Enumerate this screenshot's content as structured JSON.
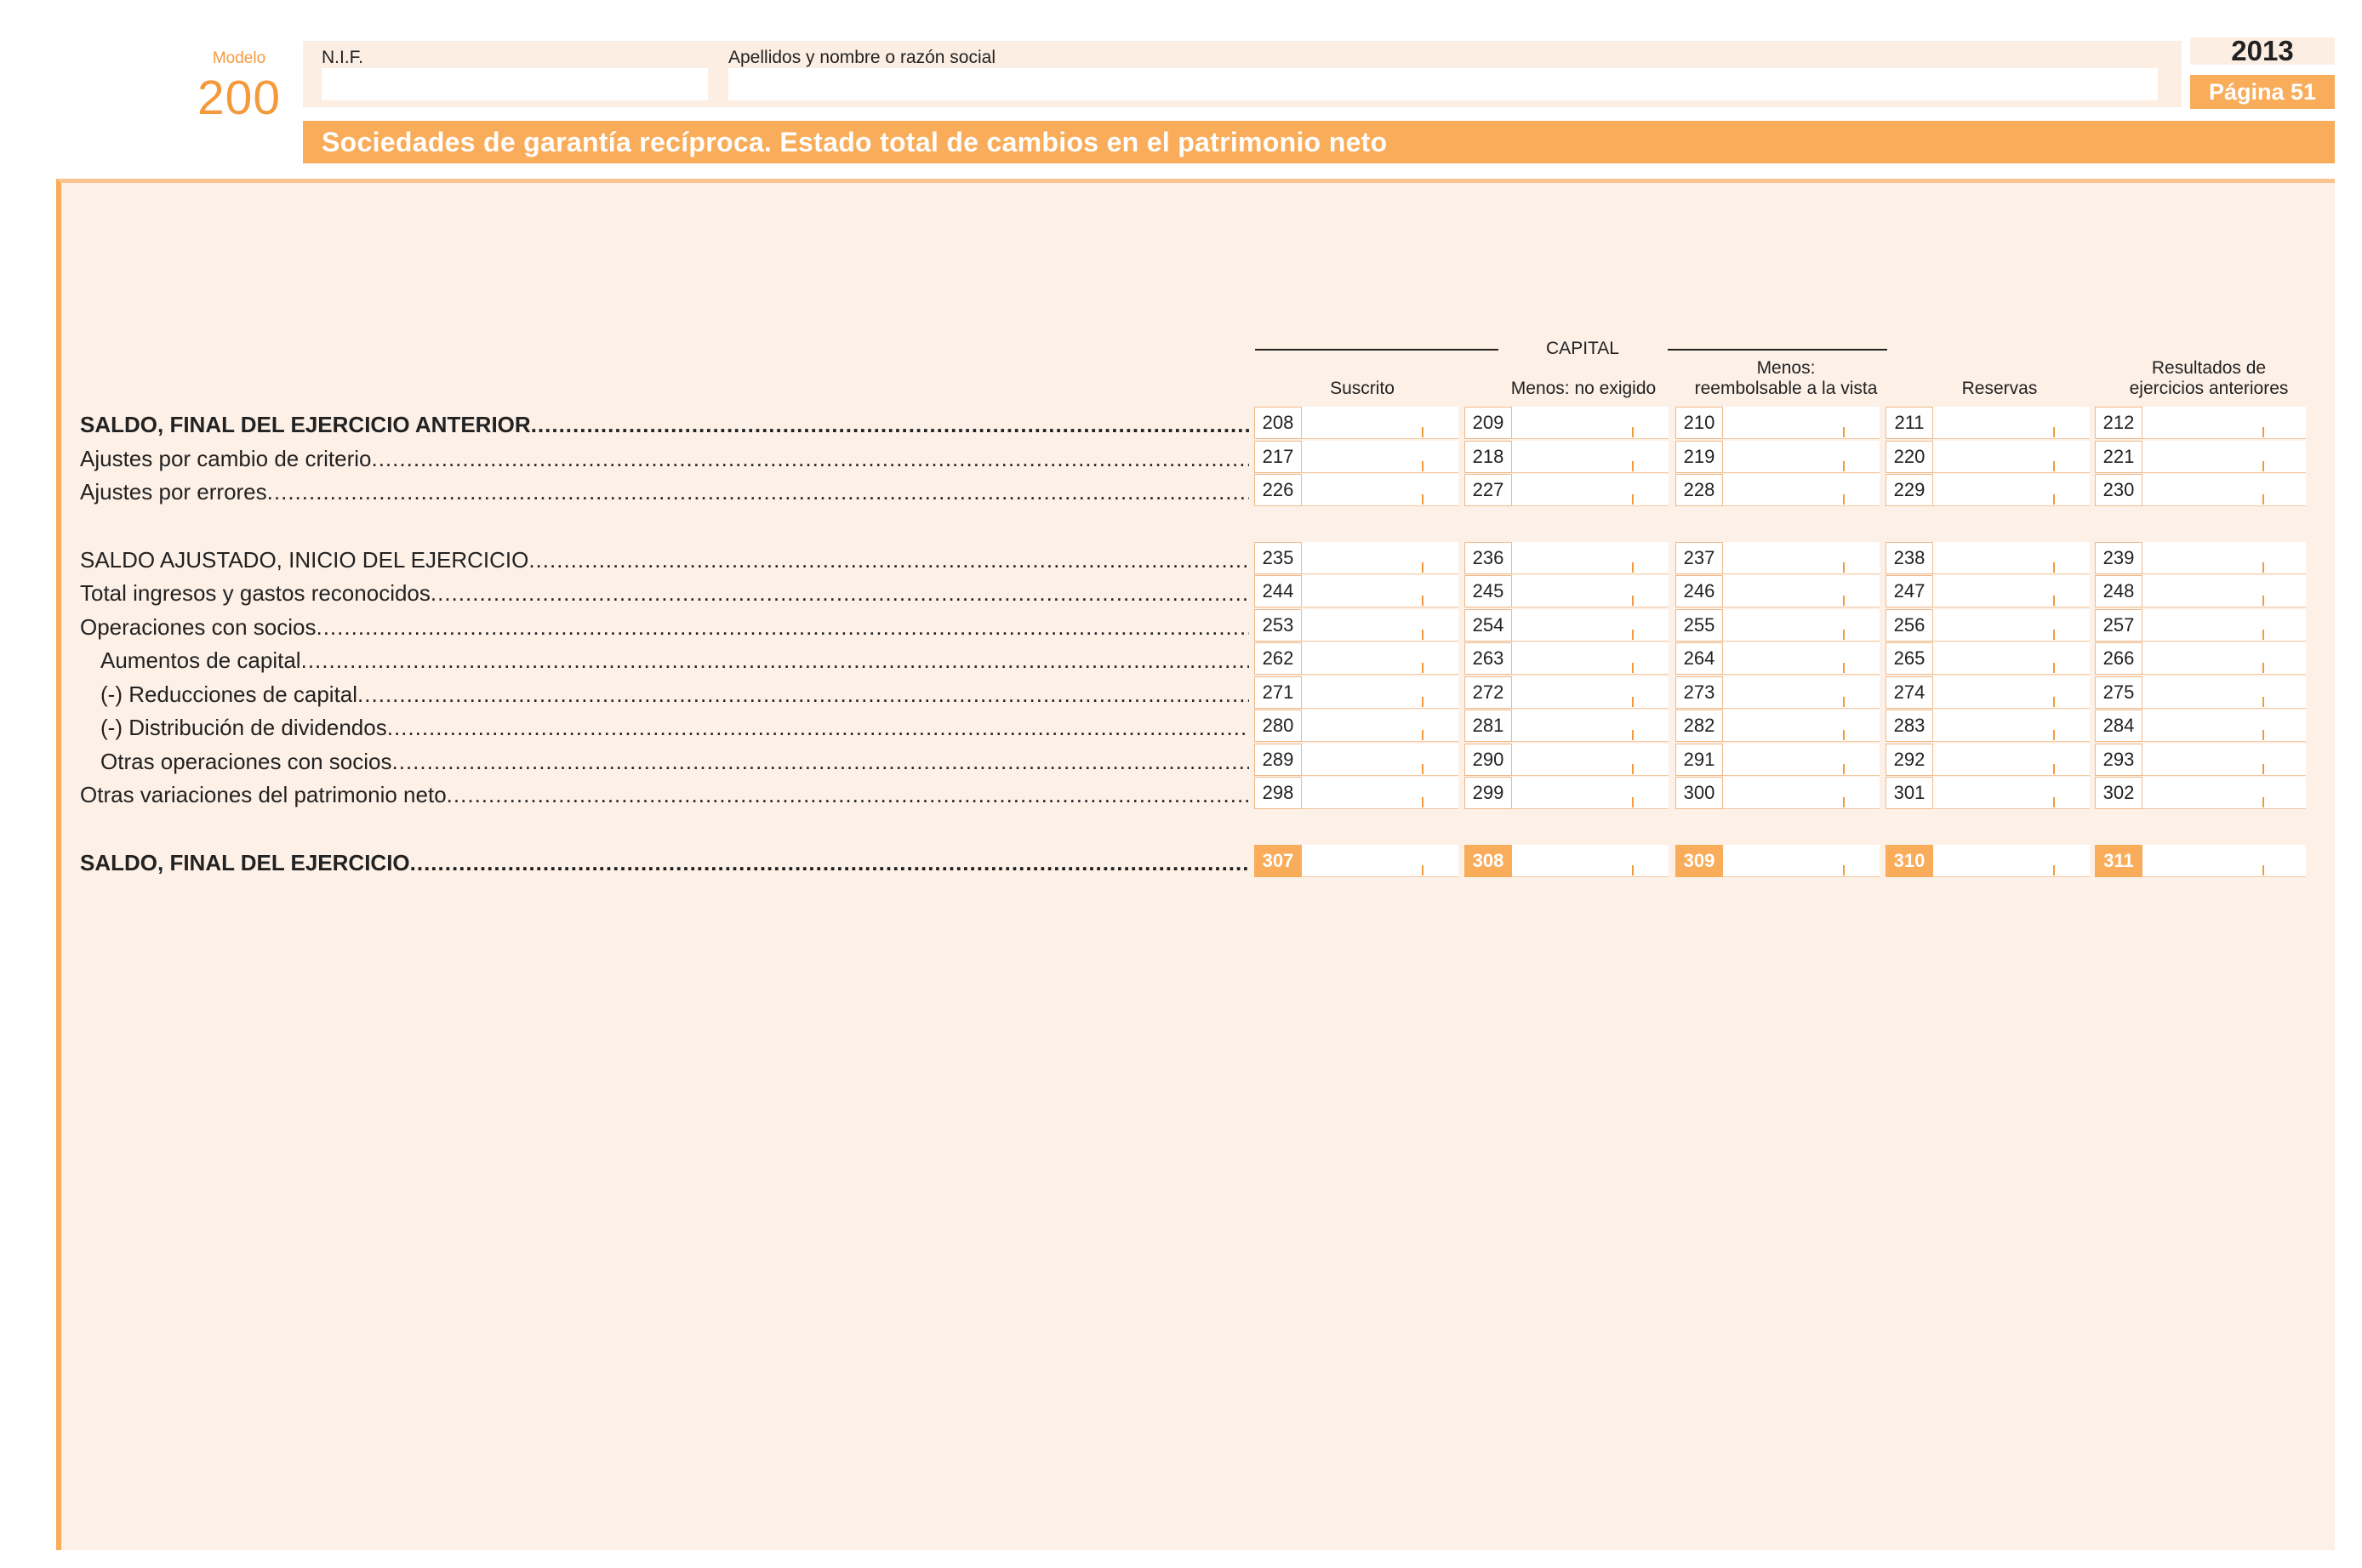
{
  "header": {
    "modelo_label": "Modelo",
    "modelo_number": "200",
    "nif_label": "N.I.F.",
    "name_label": "Apellidos y nombre o razón social",
    "nif_value": "",
    "name_value": "",
    "year": "2013",
    "page": "Página 51",
    "title": "Sociedades de garantía recíproca. Estado total de cambios en el patrimonio neto"
  },
  "table": {
    "capital_label": "CAPITAL",
    "columns": [
      {
        "line1": "",
        "line2": "Suscrito"
      },
      {
        "line1": "",
        "line2": "Menos: no exigido"
      },
      {
        "line1": "Menos:",
        "line2": "reembolsable a la vista"
      },
      {
        "line1": "",
        "line2": "Reservas"
      },
      {
        "line1": "Resultados de",
        "line2": "ejercicios anteriores"
      }
    ],
    "rows": [
      {
        "label": "SALDO, FINAL DEL EJERCICIO ANTERIOR",
        "codes": [
          "208",
          "209",
          "210",
          "211",
          "212"
        ]
      },
      {
        "label": "Ajustes por cambio de criterio",
        "codes": [
          "217",
          "218",
          "219",
          "220",
          "221"
        ]
      },
      {
        "label": "Ajustes por errores",
        "codes": [
          "226",
          "227",
          "228",
          "229",
          "230"
        ]
      },
      {
        "label": "SALDO AJUSTADO, INICIO DEL EJERCICIO",
        "codes": [
          "235",
          "236",
          "237",
          "238",
          "239"
        ]
      },
      {
        "label": "Total ingresos y gastos reconocidos",
        "codes": [
          "244",
          "245",
          "246",
          "247",
          "248"
        ]
      },
      {
        "label": "Operaciones con socios",
        "codes": [
          "253",
          "254",
          "255",
          "256",
          "257"
        ]
      },
      {
        "label": "Aumentos de capital",
        "codes": [
          "262",
          "263",
          "264",
          "265",
          "266"
        ]
      },
      {
        "label": "(-) Reducciones de capital",
        "codes": [
          "271",
          "272",
          "273",
          "274",
          "275"
        ]
      },
      {
        "label": "(-) Distribución de dividendos",
        "codes": [
          "280",
          "281",
          "282",
          "283",
          "284"
        ]
      },
      {
        "label": "Otras operaciones con socios",
        "codes": [
          "289",
          "290",
          "291",
          "292",
          "293"
        ]
      },
      {
        "label": "Otras variaciones del patrimonio neto",
        "codes": [
          "298",
          "299",
          "300",
          "301",
          "302"
        ]
      },
      {
        "label": "SALDO, FINAL DEL EJERCICIO",
        "codes": [
          "307",
          "308",
          "309",
          "310",
          "311"
        ]
      }
    ]
  }
}
